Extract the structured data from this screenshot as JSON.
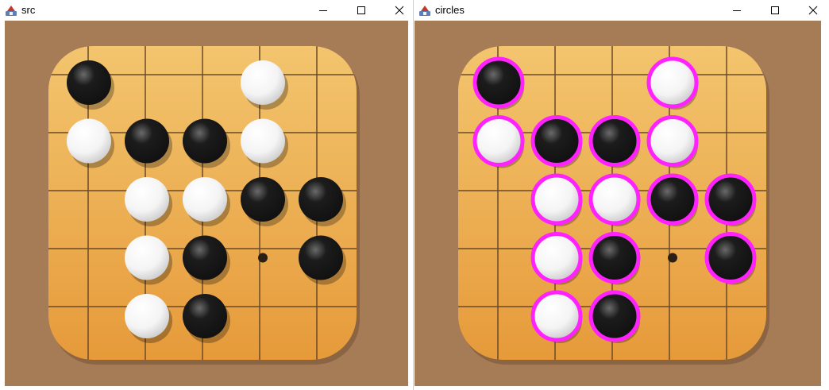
{
  "windows": [
    {
      "id": "src",
      "title": "src",
      "highlight": false
    },
    {
      "id": "circles",
      "title": "circles",
      "highlight": true
    }
  ],
  "controls": {
    "minimize_icon": "minimize-icon",
    "maximize_icon": "maximize-icon",
    "close_icon": "close-icon"
  },
  "colors": {
    "background": "#a67c57",
    "board_light": "#f3c56e",
    "board_dark": "#e69a3a",
    "grid_line": "#6b4a2a",
    "highlight_ring": "#ff22ff",
    "black_stone": "#111111",
    "white_stone": "#f4f4f4"
  },
  "board": {
    "columns": 6,
    "rows": 6,
    "stones": [
      {
        "col": 0,
        "row": 0,
        "color": "black"
      },
      {
        "col": 3,
        "row": 0,
        "color": "white"
      },
      {
        "col": 0,
        "row": 1,
        "color": "white"
      },
      {
        "col": 1,
        "row": 1,
        "color": "black"
      },
      {
        "col": 2,
        "row": 1,
        "color": "black"
      },
      {
        "col": 3,
        "row": 1,
        "color": "white"
      },
      {
        "col": 1,
        "row": 2,
        "color": "white"
      },
      {
        "col": 2,
        "row": 2,
        "color": "white"
      },
      {
        "col": 3,
        "row": 2,
        "color": "black"
      },
      {
        "col": 4,
        "row": 2,
        "color": "black"
      },
      {
        "col": 1,
        "row": 3,
        "color": "white"
      },
      {
        "col": 2,
        "row": 3,
        "color": "black"
      },
      {
        "col": 4,
        "row": 3,
        "color": "black"
      },
      {
        "col": 1,
        "row": 4,
        "color": "white"
      },
      {
        "col": 2,
        "row": 4,
        "color": "black"
      }
    ],
    "star_points": [
      {
        "col": 3,
        "row": 3
      }
    ]
  }
}
